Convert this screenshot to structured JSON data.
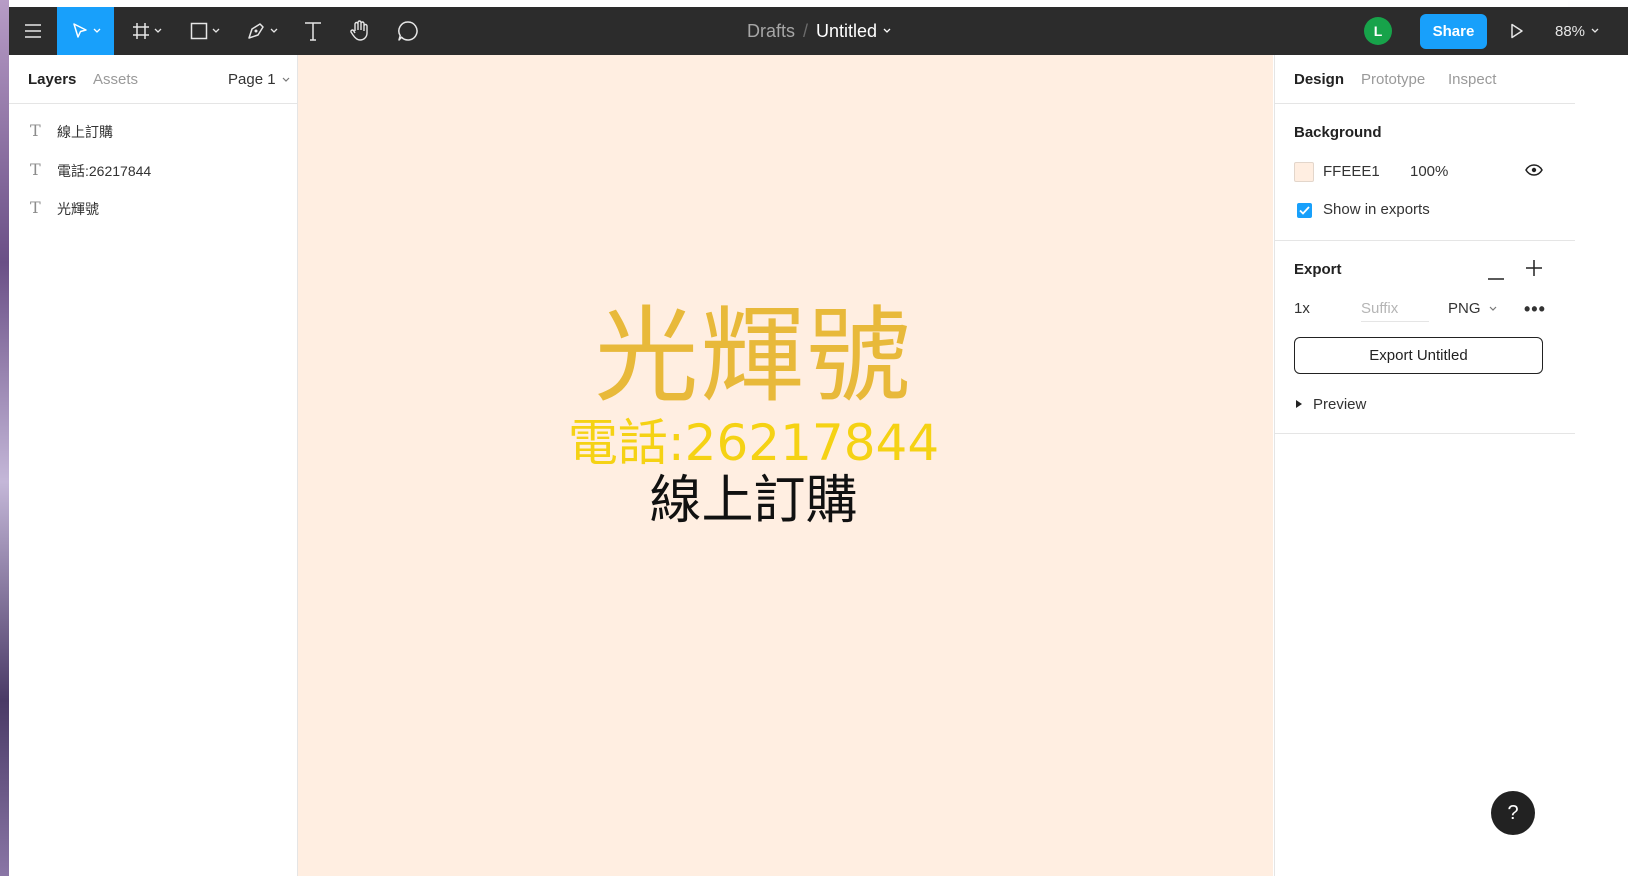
{
  "toolbar": {
    "breadcrumb_parent": "Drafts",
    "breadcrumb_separator": "/",
    "file_name": "Untitled",
    "avatar_initial": "L",
    "share_label": "Share",
    "zoom": "88%"
  },
  "left_panel": {
    "tabs": [
      {
        "label": "Layers"
      },
      {
        "label": "Assets"
      }
    ],
    "page": "Page 1",
    "layers": [
      {
        "icon": "text-icon",
        "name": "線上訂購"
      },
      {
        "icon": "text-icon",
        "name": "電話:26217844"
      },
      {
        "icon": "text-icon",
        "name": "光輝號"
      }
    ]
  },
  "canvas": {
    "background": "#FFEEE1",
    "texts": [
      {
        "text": "光輝號",
        "color": "#E8B93A"
      },
      {
        "text": "電話:26217844",
        "color": "#F5D214"
      },
      {
        "text": "線上訂購",
        "color": "#111111"
      }
    ]
  },
  "right_panel": {
    "tabs": [
      {
        "label": "Design"
      },
      {
        "label": "Prototype"
      },
      {
        "label": "Inspect"
      }
    ],
    "background": {
      "title": "Background",
      "hex": "FFEEE1",
      "opacity": "100%",
      "show_in_exports": "Show in exports"
    },
    "export": {
      "title": "Export",
      "scale": "1x",
      "suffix_placeholder": "Suffix",
      "format": "PNG",
      "button": "Export Untitled",
      "preview": "Preview"
    }
  },
  "help_label": "?"
}
